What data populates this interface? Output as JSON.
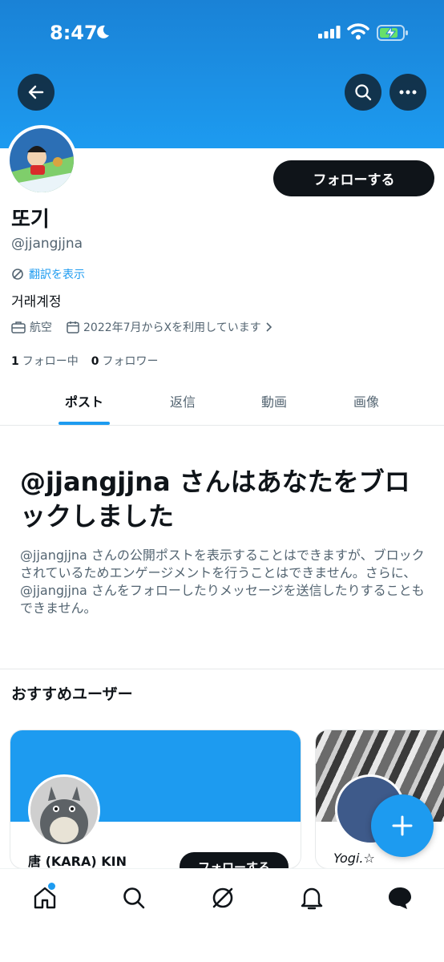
{
  "status_bar": {
    "time": "8:47"
  },
  "profile": {
    "display_name": "또기",
    "handle": "@jjangjjna",
    "follow_button_label": "フォローする",
    "translate_label": "翻訳を表示",
    "bio": "거래계정",
    "category": "航空",
    "joined": "2022年7月からXを利用しています",
    "following_count": "1",
    "following_label": "フォロー中",
    "followers_count": "0",
    "followers_label": "フォロワー"
  },
  "tabs": [
    "ポスト",
    "返信",
    "動画",
    "画像"
  ],
  "active_tab": "ポスト",
  "blocked": {
    "title": "@jjangjjna さんはあなたをブロックしました",
    "description": "@jjangjjna さんの公開ポストを表示することはできますが、ブロックされているためエンゲージメントを行うことはできません。さらに、@jjangjjna さんをフォローしたりメッセージを送信したりすることもできません。"
  },
  "recommendations": {
    "heading": "おすすめユーザー",
    "users": [
      {
        "name": "唐 (KARA) KIN",
        "follow_label": "フォローする"
      },
      {
        "name": "Yogi.☆"
      }
    ]
  },
  "bottom_nav": [
    "home-icon",
    "search-icon",
    "grok-icon",
    "notifications-icon",
    "messages-icon"
  ],
  "colors": {
    "accent": "#1d9bf0",
    "text": "#0f1419",
    "secondary_text": "#536471"
  }
}
